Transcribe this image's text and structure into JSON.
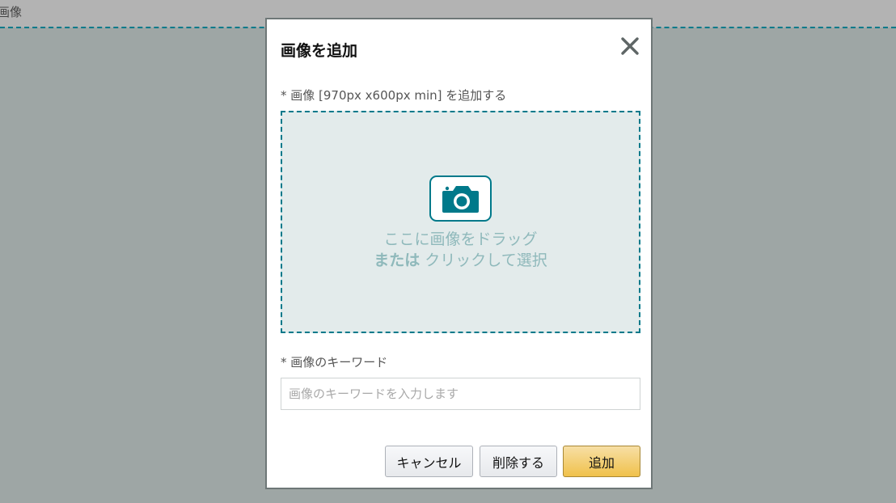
{
  "background": {
    "header_label": "画像"
  },
  "modal": {
    "title": "画像を追加",
    "close_icon": "close-icon",
    "image_field": {
      "label": "* 画像 [970px x600px min] を追加する",
      "dropzone_icon": "camera-icon",
      "drop_text_line1": "ここに画像をドラッグ",
      "drop_text_or": "または",
      "drop_text_line2": " クリックして選択"
    },
    "keyword_field": {
      "label": "* 画像のキーワード",
      "placeholder": "画像のキーワードを入力します",
      "value": ""
    },
    "buttons": {
      "cancel_label": "キャンセル",
      "delete_label": "削除する",
      "add_label": "追加"
    }
  },
  "colors": {
    "accent": "#00798a",
    "dropzone_bg": "#e3ebeb",
    "drop_text": "#8fb9bb",
    "primary_button": "#f0c14b",
    "overlay": "#9ea6a5"
  }
}
